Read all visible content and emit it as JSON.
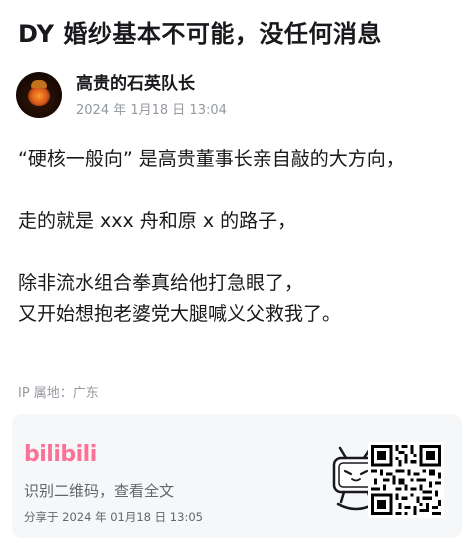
{
  "post": {
    "title": "DY 婚纱基本不可能，没任何消息",
    "author_name": "高贵的石英队长",
    "post_time": "2024 年 1月18 日 13:04",
    "paragraphs": [
      "“硬核一般向” 是高贵董事长亲自敲的大方向，",
      "走的就是 xxx 舟和原 x 的路子，",
      "除非流水组合拳真给他打急眼了，",
      "又开始想抱老婆党大腿喊义父救我了。"
    ],
    "ip_location": "IP 属地：广东"
  },
  "share_card": {
    "brand": "bilibili",
    "scan_text": "识别二维码，查看全文",
    "share_time": "分享于 2024 年 01月18 日 13:05"
  },
  "icons": {
    "avatar": "author-avatar",
    "mascot": "bilibili-tv-mascot-icon",
    "qr": "qr-code-icon"
  },
  "colors": {
    "brand_pink": "#fb7299",
    "muted_text": "#9499a0",
    "body_text": "#18191c",
    "card_bg": "#f6f7f8"
  }
}
